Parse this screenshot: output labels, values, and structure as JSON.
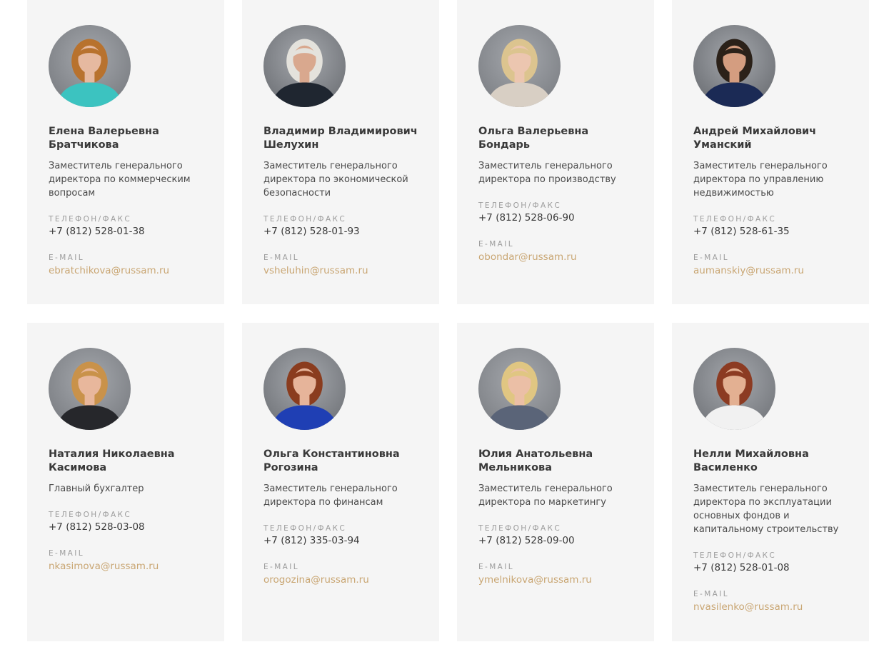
{
  "labels": {
    "phone": "Телефон/Факс",
    "email": "E-mail"
  },
  "colors": {
    "card_bg": "#f5f5f5",
    "email_link": "#c9a673",
    "label_gray": "#9c9c9c",
    "text_dark": "#3a3a3a"
  },
  "people": [
    {
      "first_line": "Елена Валерьевна",
      "last_line": "Братчикова",
      "position": "Заместитель генерального\nдиректора по коммерческим\nвопросам",
      "phone": "+7 (812) 528-01-38",
      "email": "ebratchikova@russam.ru",
      "photo": {
        "bg": "#7a7d82",
        "hair": "#b8722e",
        "clothes": "#3cc3c0",
        "skin": "#e6b9a0"
      }
    },
    {
      "first_line": "Владимир Владимирович",
      "last_line": "Шелухин",
      "position": "Заместитель генерального\nдиректора по экономической\nбезопасности",
      "phone": "+7 (812) 528-01-93",
      "email": "vsheluhin@russam.ru",
      "photo": {
        "bg": "#6f7277",
        "hair": "#e4e2dc",
        "clothes": "#1f2630",
        "skin": "#d9a88e"
      }
    },
    {
      "first_line": "Ольга Валерьевна",
      "last_line": "Бондарь",
      "position": "Заместитель генерального\nдиректора по производству",
      "phone": "+7 (812) 528-06-90",
      "email": "obondar@russam.ru",
      "photo": {
        "bg": "#7d8085",
        "hair": "#dcc48f",
        "clothes": "#d8cfc4",
        "skin": "#ecc6b0"
      }
    },
    {
      "first_line": "Андрей Михайлович",
      "last_line": "Уманский",
      "position": "Заместитель генерального\nдиректора по управлению\nнедвижимостью",
      "phone": "+7 (812) 528-61-35",
      "email": "aumanskiy@russam.ru",
      "photo": {
        "bg": "#6c6f74",
        "hair": "#2b2119",
        "clothes": "#1b2a55",
        "skin": "#d49d80"
      }
    },
    {
      "first_line": "Наталия Николаевна",
      "last_line": "Касимова",
      "position": "Главный бухгалтер",
      "phone": "+7 (812) 528-03-08",
      "email": "nkasimova@russam.ru",
      "photo": {
        "bg": "#7b7e83",
        "hair": "#c9924a",
        "clothes": "#26272b",
        "skin": "#e8b79c"
      }
    },
    {
      "first_line": "Ольга Константиновна",
      "last_line": "Рогозина",
      "position": "Заместитель генерального\nдиректора по финансам",
      "phone": "+7 (812) 335-03-94",
      "email": "orogozina@russam.ru",
      "photo": {
        "bg": "#72757a",
        "hair": "#8a3c1e",
        "clothes": "#1f3fb4",
        "skin": "#e6b49a"
      }
    },
    {
      "first_line": "Юлия Анатольевна",
      "last_line": "Мельникова",
      "position": "Заместитель генерального\nдиректора по маркетингу",
      "phone": "+7 (812) 528-09-00",
      "email": "ymelnikova@russam.ru",
      "photo": {
        "bg": "#7e8186",
        "hair": "#e0c682",
        "clothes": "#5a6478",
        "skin": "#ebbfa6"
      }
    },
    {
      "first_line": "Нелли Михайловна",
      "last_line": "Василенко",
      "position": "Заместитель генерального\nдиректора по эксплуатации\nосновных фондов и\nкапитальному строительству",
      "phone": "+7 (812) 528-01-08",
      "email": "nvasilenko@russam.ru",
      "photo": {
        "bg": "#74777c",
        "hair": "#8c3b22",
        "clothes": "#f1f1f1",
        "skin": "#e3b092"
      }
    }
  ]
}
